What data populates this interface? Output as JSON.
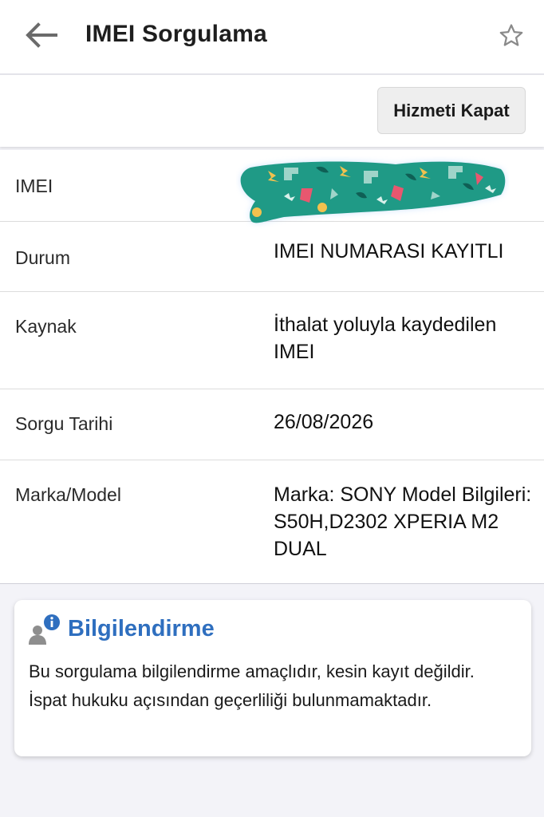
{
  "header": {
    "title": "IMEI Sorgulama",
    "back_icon": "arrow-left-icon",
    "favorite_icon": "star-outline-icon"
  },
  "actions": {
    "close_service_label": "Hizmeti Kapat"
  },
  "details": {
    "imei": {
      "label": "IMEI",
      "value_redacted": true
    },
    "status": {
      "label": "Durum",
      "value": "IMEI NUMARASI KAYITLI"
    },
    "source": {
      "label": "Kaynak",
      "value": "İthalat yoluyla kaydedilen IMEI"
    },
    "query_date": {
      "label": "Sorgu Tarihi",
      "value": "26/08/2026"
    },
    "brand_model": {
      "label": "Marka/Model",
      "value": "Marka: SONY Model Bilgileri: S50H,D2302 XPERIA M2 DUAL"
    }
  },
  "info": {
    "title": "Bilgilendirme",
    "icon": "user-info-icon",
    "text": "Bu sorgulama bilgilendirme amaçlıdır, kesin kayıt değildir. İspat hukuku açısından geçerliliği bulunmamaktadır."
  },
  "colors": {
    "accent": "#2f6fbf",
    "background": "#f3f3f8",
    "redaction_base": "#1f9a86"
  }
}
